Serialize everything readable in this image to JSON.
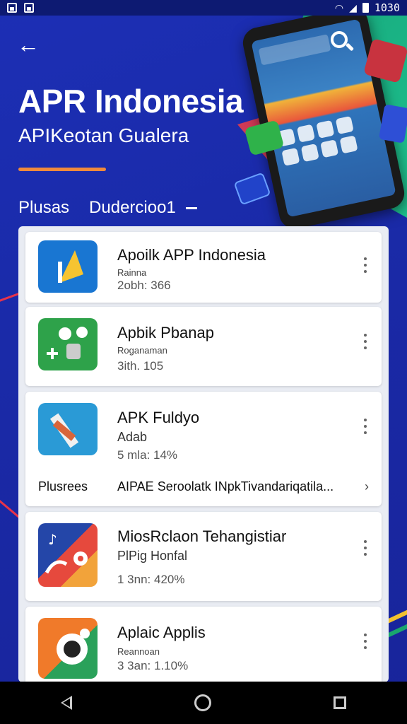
{
  "statusbar": {
    "time": "1030"
  },
  "header": {
    "title": "APR Indonesia",
    "subtitle": "APIKeotan Gualera"
  },
  "filters": [
    "Plusas",
    "Dudercioo1"
  ],
  "apps": [
    {
      "name": "Apoilk APP Indonesia",
      "meta": "Rainna",
      "stat": "2obh: 366",
      "icon": "music-note-icon"
    },
    {
      "name": "Apbik Pbanap",
      "meta": "Roganaman",
      "stat": "3ith. 105",
      "icon": "game-controller-icon"
    },
    {
      "name": "APK Fuldyo",
      "meta": "Adab",
      "stat": "5 mla: 14%",
      "icon": "tools-icon",
      "footer_left": "Plusrees",
      "footer_right": "AIPAE Seroolatk  INpkTivandariqatila..."
    },
    {
      "name": "MiosRclaon Tehangistiar",
      "meta": "PlPig Honfal",
      "stat": "1 3nn: 420%",
      "icon": "music-player-icon"
    },
    {
      "name": "Aplaic Applis",
      "meta": "Reannoan",
      "stat": "3 3an: 1.10%",
      "icon": "camera-icon"
    }
  ]
}
